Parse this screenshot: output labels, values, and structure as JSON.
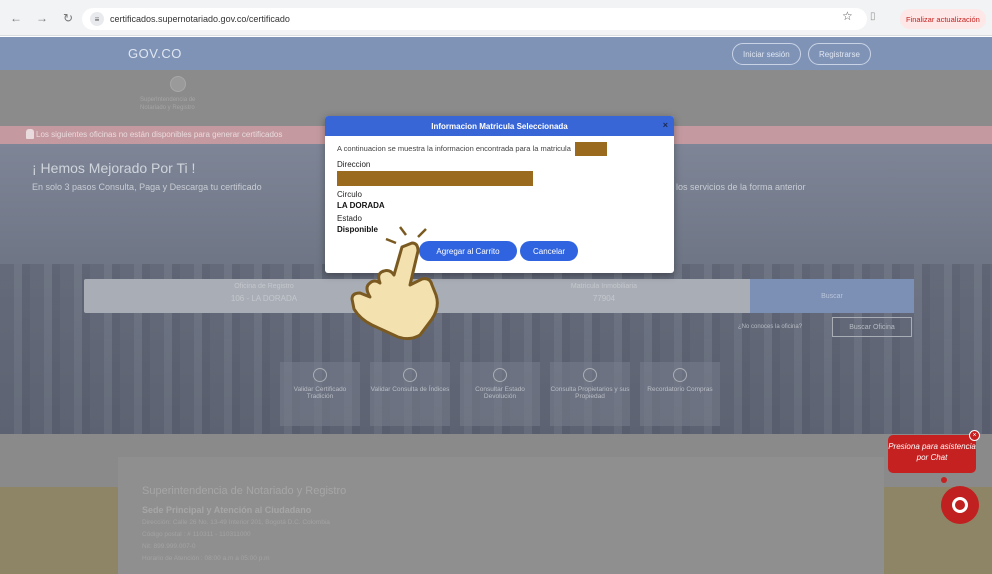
{
  "browser": {
    "url": "certificados.supernotariado.gov.co/certificado",
    "update_label": "Finalizar actualización"
  },
  "header": {
    "logo": "GOV.CO",
    "login_label": "Iniciar sesión",
    "register_label": "Registrarse"
  },
  "brand": {
    "line1": "SuperIntendencia de",
    "line2": "Notariado y Registro"
  },
  "alert": {
    "text": "Los siguientes oficinas no están disponibles para generar certificados"
  },
  "hero": {
    "title": "¡ Hemos Mejorado Por Ti !",
    "subtitle": "En solo 3 pasos Consulta, Paga y Descarga tu certificado",
    "subtitle_right": "los servicios de la forma anterior"
  },
  "search": {
    "office_label": "Oficina de Registro",
    "office_value": "106 - LA DORADA",
    "matricula_label": "Matricula Inmobiliaria",
    "matricula_value": "77904",
    "button": "Buscar",
    "office_question": "¿No conoces la oficina?",
    "office_button": "Buscar Oficina"
  },
  "tiles": [
    {
      "label": "Validar Certificado Tradición"
    },
    {
      "label": "Validar Consulta de Índices"
    },
    {
      "label": "Consultar Estado Devolución"
    },
    {
      "label": "Consulta Propietarios y sus Propiedad"
    },
    {
      "label": "Recordatorio Compras"
    }
  ],
  "footer": {
    "title": "Superintendencia de Notariado y Registro",
    "subtitle": "Sede Principal y Atención al Ciudadano",
    "lines": [
      "Dirección: Calle 26 No. 13-49 Interior 201, Bogotá D.C. Colombia",
      "Código postal : # 110311 - 110311000",
      "Nit: 899.999.007-0",
      "Horario de Atención : 08:00 a.m a 05:00 p.m"
    ]
  },
  "modal": {
    "title": "Informacion Matricula Seleccionada",
    "close": "×",
    "intro": "A continuacion se muestra la informacion encontrada para la matricula",
    "direccion_label": "Direccion",
    "circulo_label": "Circulo",
    "circulo_value": "LA DORADA",
    "estado_label": "Estado",
    "estado_value": "Disponible",
    "add_button": "Agregar al Carrito",
    "cancel_button": "Cancelar"
  },
  "chat": {
    "bubble": "Presiona para asistencia por Chat",
    "close": "×"
  },
  "colors": {
    "modal_header": "#3866d6",
    "primary_button": "#2f63e0",
    "chat_red": "#c62121",
    "redaction": "#9a6b1f"
  }
}
